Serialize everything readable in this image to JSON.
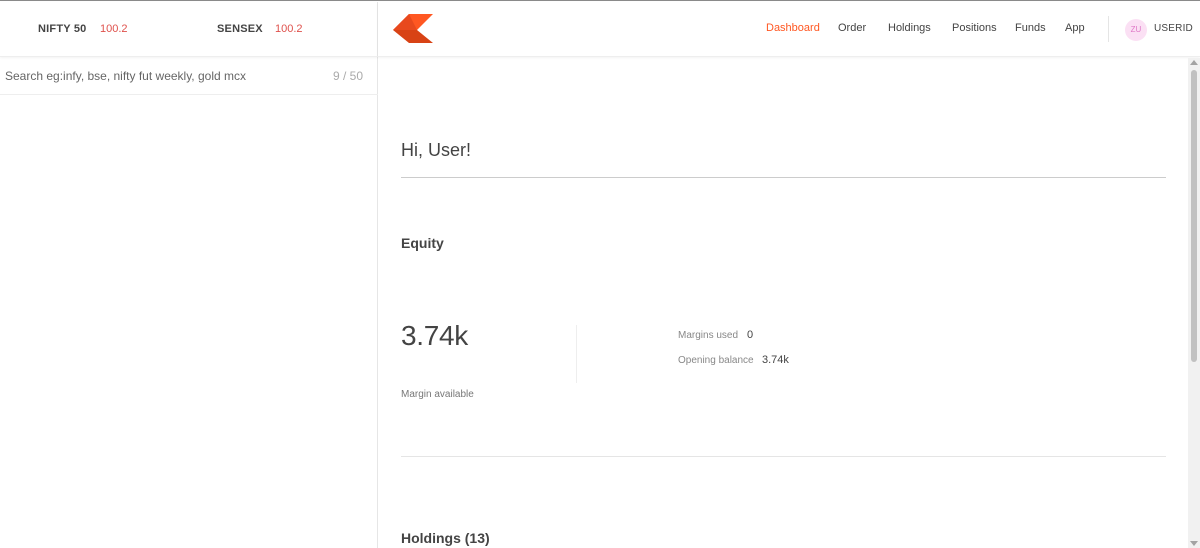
{
  "indices": [
    {
      "name": "NIFTY 50",
      "value": "100.2"
    },
    {
      "name": "SENSEX",
      "value": "100.2"
    }
  ],
  "search": {
    "placeholder": "Search eg:infy, bse, nifty fut weekly, gold mcx",
    "count": "9 / 50"
  },
  "header": {
    "logo_icon": "kite-logo-icon",
    "brand_colors": {
      "primary": "#ff5722",
      "secondary": "#d84315"
    },
    "nav": [
      {
        "label": "Dashboard",
        "active": true
      },
      {
        "label": "Order",
        "active": false
      },
      {
        "label": "Holdings",
        "active": false
      },
      {
        "label": "Positions",
        "active": false
      },
      {
        "label": "Funds",
        "active": false
      },
      {
        "label": "App",
        "active": false
      }
    ],
    "avatar_initials": "ZU",
    "user_id": "USERID"
  },
  "main": {
    "greeting": "Hi, User!",
    "equity": {
      "title": "Equity",
      "margin_available_value": "3.74k",
      "margin_available_label": "Margin available",
      "margins_used_label": "Margins used",
      "margins_used_value": "0",
      "opening_balance_label": "Opening balance",
      "opening_balance_value": "3.74k"
    },
    "holdings_title": "Holdings (13)"
  },
  "colors": {
    "accent": "#ff5722",
    "index_value": "#df514c",
    "avatar_bg": "#fbe0f4",
    "avatar_text": "#e07ac8"
  }
}
